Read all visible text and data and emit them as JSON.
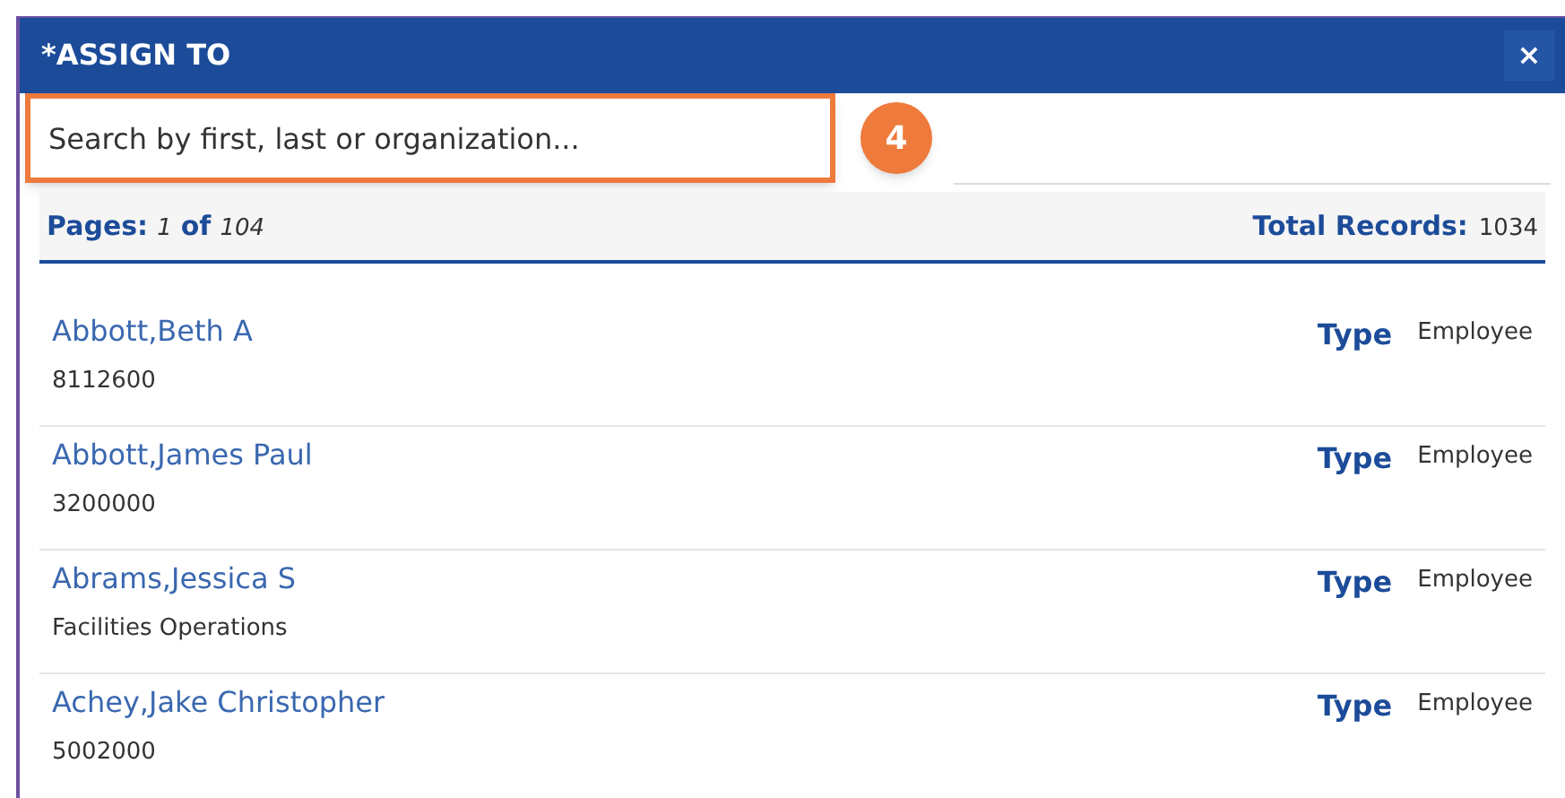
{
  "dialog": {
    "title": "*ASSIGN TO",
    "close": "×"
  },
  "search": {
    "placeholder": "Search by first, last or organization..."
  },
  "step_badge": "4",
  "pager": {
    "pages_label": "Pages:",
    "page": "1",
    "of_label": "of",
    "page_count": "104",
    "total_label": "Total Records:",
    "total": "1034"
  },
  "records": [
    {
      "name": "Abbott,Beth A",
      "detail": "8112600",
      "type_label": "Type",
      "type": "Employee"
    },
    {
      "name": "Abbott,James Paul",
      "detail": "3200000",
      "type_label": "Type",
      "type": "Employee"
    },
    {
      "name": "Abrams,Jessica S",
      "detail": "Facilities Operations",
      "type_label": "Type",
      "type": "Employee"
    },
    {
      "name": "Achey,Jake Christopher",
      "detail": "5002000",
      "type_label": "Type",
      "type": "Employee"
    }
  ]
}
